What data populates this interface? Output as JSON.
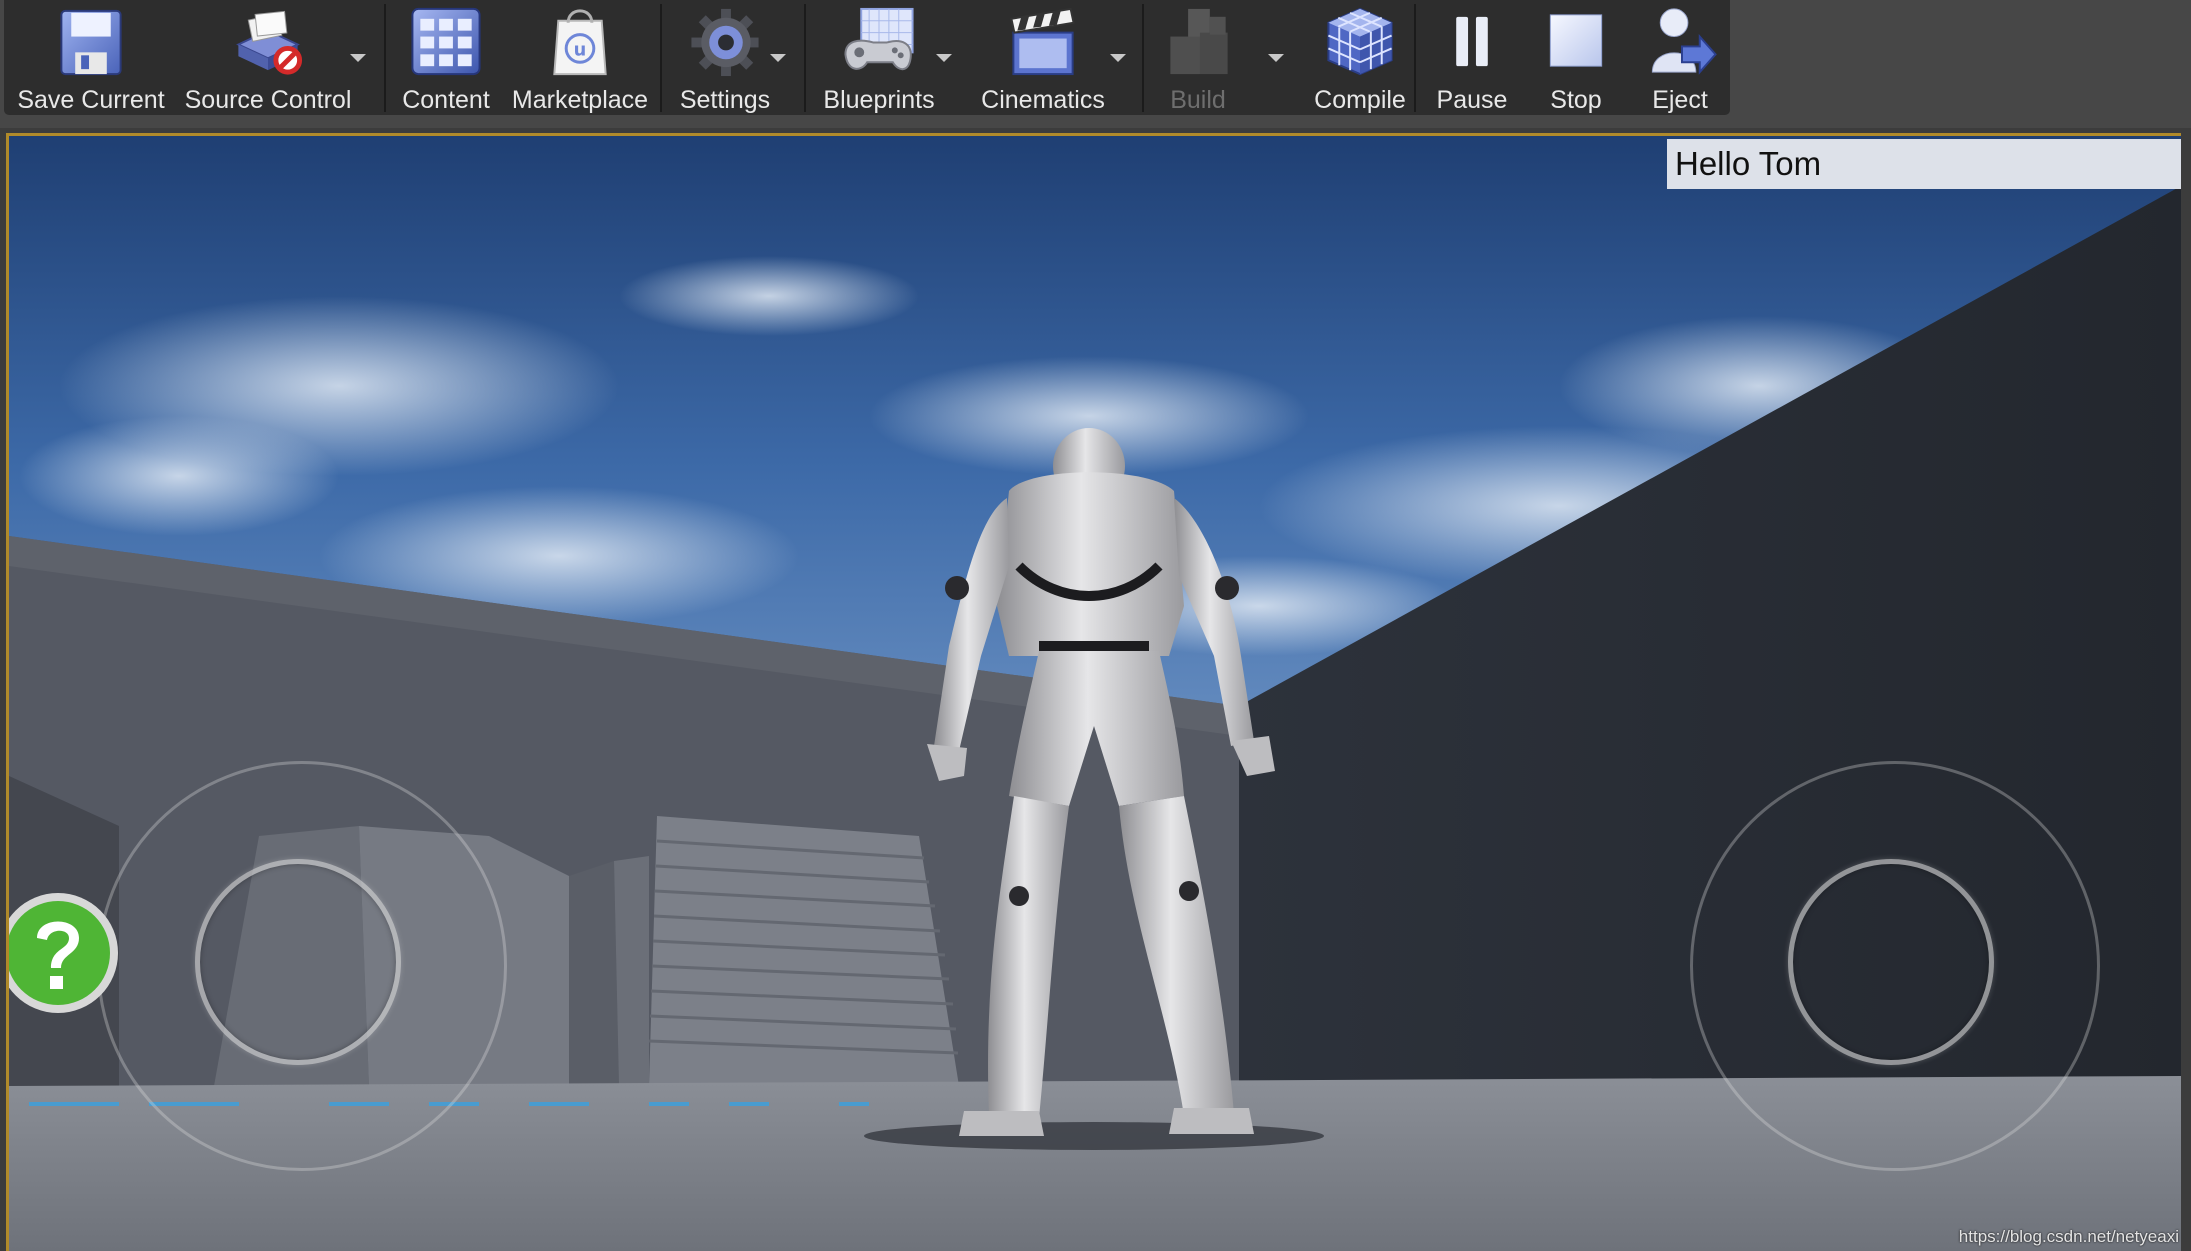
{
  "toolbar": {
    "buttons": [
      {
        "label": "Save Current"
      },
      {
        "label": "Source Control"
      },
      {
        "label": "Content"
      },
      {
        "label": "Marketplace"
      },
      {
        "label": "Settings"
      },
      {
        "label": "Blueprints"
      },
      {
        "label": "Cinematics"
      },
      {
        "label": "Build"
      },
      {
        "label": "Compile"
      },
      {
        "label": "Pause"
      },
      {
        "label": "Stop"
      },
      {
        "label": "Eject"
      }
    ]
  },
  "viewport": {
    "greeting": "Hello Tom",
    "watermark": "https://blog.csdn.net/netyeaxi"
  },
  "colors": {
    "viewport_border": "#b08a2a",
    "toolbar_bg": "#2d2d2d",
    "greeting_bg": "#dde1e9"
  }
}
